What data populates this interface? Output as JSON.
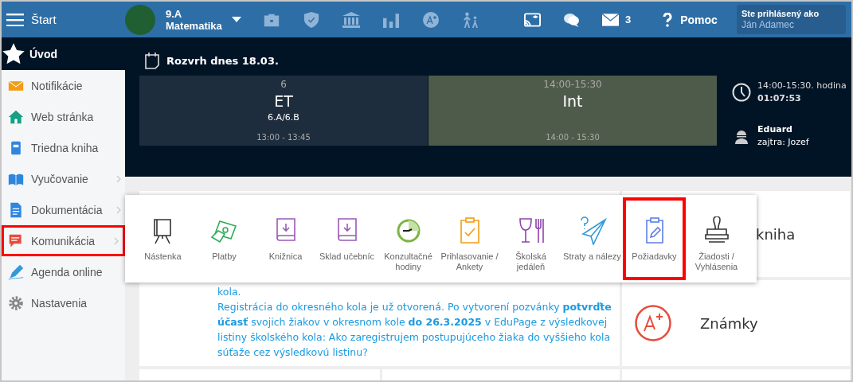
{
  "top_bar": {
    "menu_label": "Štart",
    "class_name": "9.A",
    "subject": "Matematika",
    "mail_count": "3",
    "help_label": "Pomoc",
    "login": {
      "caption": "Ste prihlásený ako",
      "user": "Ján Adamec"
    }
  },
  "sidebar": {
    "header": "Úvod",
    "items": [
      {
        "label": "Notifikácie",
        "has_submenu": false,
        "highlighted": false
      },
      {
        "label": "Web stránka",
        "has_submenu": false,
        "highlighted": false
      },
      {
        "label": "Triedna kniha",
        "has_submenu": false,
        "highlighted": false
      },
      {
        "label": "Vyučovanie",
        "has_submenu": true,
        "highlighted": false
      },
      {
        "label": "Dokumentácia",
        "has_submenu": true,
        "highlighted": false
      },
      {
        "label": "Komunikácia",
        "has_submenu": true,
        "highlighted": true
      },
      {
        "label": "Agenda online",
        "has_submenu": false,
        "highlighted": false
      },
      {
        "label": "Nastavenia",
        "has_submenu": false,
        "highlighted": false
      }
    ]
  },
  "schedule": {
    "title": "Rozvrh dnes 18.03.",
    "lessons": [
      {
        "period": "6",
        "subject": "ET",
        "classes": "6.A/6.B",
        "time": "13:00 - 13:45",
        "current": false
      },
      {
        "period": "14:00-15:30",
        "subject": "Int",
        "time": "14:00 - 15:30",
        "current": true
      }
    ],
    "status": {
      "period_text": "14:00-15:30. hodina",
      "countdown": "01:07:53"
    },
    "duty": {
      "name": "Eduard",
      "tomorrow": "zajtra: Jozef"
    }
  },
  "popup_menu": {
    "items": [
      {
        "label": "Nástenka",
        "highlighted": false
      },
      {
        "label": "Platby",
        "highlighted": false
      },
      {
        "label": "Knižnica",
        "highlighted": false
      },
      {
        "label": "Sklad učebníc",
        "highlighted": false
      },
      {
        "label": "Konzultačné hodiny",
        "highlighted": false
      },
      {
        "label": "Prihlasovanie / Ankety",
        "highlighted": false
      },
      {
        "label": "Školská jedáleň",
        "highlighted": false
      },
      {
        "label": "Straty a nálezy",
        "highlighted": false
      },
      {
        "label": "Požiadavky",
        "highlighted": true
      },
      {
        "label": "Žiadosti / Vyhlásenia",
        "highlighted": false
      }
    ]
  },
  "news": {
    "lines": [
      "kola.",
      "Registrácia do okresného kola je už otvorená. Po vytvorení pozvánky **potvrďte účasť** svojich žiakov v okresnom kole **do 26.3.2025** v EduPage z výsledkovej listiny školského kola: Ako zaregistrujem postupujúceho žiaka do vyššieho kola súťaže cez výsledkovú listinu?"
    ]
  },
  "tiles": [
    {
      "label": "kniha",
      "kind": "plain"
    },
    {
      "label": "Známky",
      "kind": "grade"
    }
  ]
}
